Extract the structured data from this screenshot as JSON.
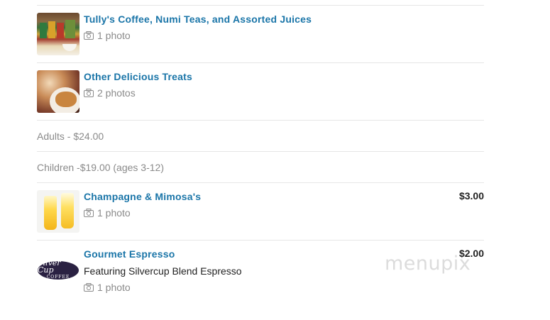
{
  "items": [
    {
      "title": "Tully's Coffee, Numi Teas, and Assorted Juices",
      "photos": "1 photo",
      "price": "",
      "description": ""
    },
    {
      "title": "Other Delicious Treats",
      "photos": "2 photos",
      "price": "",
      "description": ""
    },
    {
      "text": "Adults - $24.00"
    },
    {
      "text": "Children -$19.00 (ages 3-12)"
    },
    {
      "title": "Champagne & Mimosa's",
      "photos": "1 photo",
      "price": "$3.00",
      "description": ""
    },
    {
      "title": "Gourmet Espresso",
      "photos": "1 photo",
      "price": "$2.00",
      "description": "Featuring Silvercup Blend Espresso",
      "logo_text": "Silver Cup",
      "logo_subtext": "COFFEE"
    }
  ],
  "watermark": "menupix",
  "icons": {
    "photo": "camera-icon"
  },
  "colors": {
    "link": "#1a75a8",
    "muted": "#8a8a8a",
    "divider": "#e6e6e6"
  }
}
